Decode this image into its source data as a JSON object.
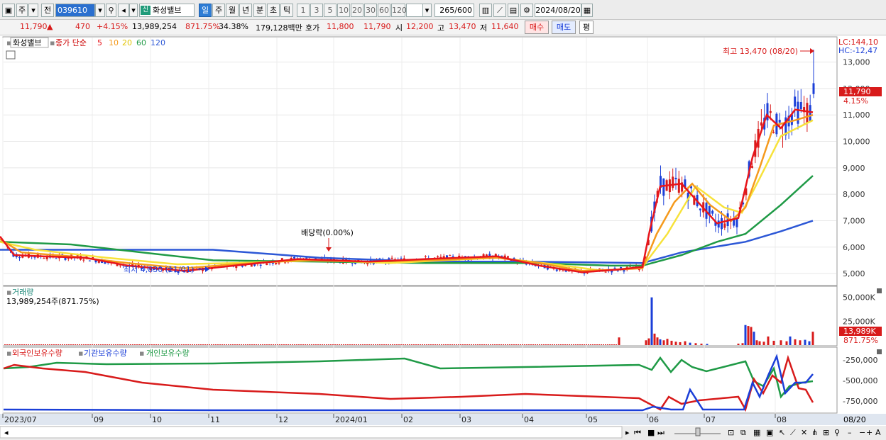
{
  "toolbar": {
    "type_label": "주",
    "all_label": "전",
    "code": "039610",
    "name_badge": "신",
    "stock_name": "화성밸브",
    "periods": [
      "일",
      "주",
      "월",
      "년",
      "분",
      "초",
      "틱"
    ],
    "active_period": "일",
    "intervals": [
      "1",
      "3",
      "5",
      "10",
      "20",
      "30",
      "60",
      "120"
    ],
    "count": "265",
    "count_max": "/600",
    "date": "2024/08/20"
  },
  "quote": {
    "price": "11,790",
    "change": "470",
    "change_pct": "+4.15%",
    "volume": "13,989,254",
    "volume_pct": "871.75%",
    "turnover": "34.38%",
    "amount": "179,128백만",
    "ask_label": "호가",
    "ask": "11,800",
    "bid": "11,790",
    "open_label": "시",
    "open": "12,200",
    "high_label": "고",
    "high": "13,470",
    "low_label": "저",
    "low": "11,640",
    "buy_label": "매수",
    "sell_label": "매도",
    "eval_label": "평"
  },
  "colors": {
    "up": "#d81b1b",
    "down": "#1b3fd8",
    "ma5": "#e8151b",
    "ma10": "#f59a1d",
    "ma20": "#f7e23a",
    "ma60": "#1f9a46",
    "ma120": "#2c57d6"
  },
  "chart_data": [
    {
      "type": "candlestick",
      "panel": "price",
      "legend": {
        "name": "화성밸브",
        "prefix": "종가 단순",
        "ma": [
          "5",
          "10",
          "20",
          "60",
          "120"
        ]
      },
      "lc_label": "LC:144,10",
      "hc_label": "HC:-12,47",
      "yticks": [
        "13,000",
        "12,000",
        "11,000",
        "10,000",
        "9,000",
        "8,000",
        "7,000",
        "6,000",
        "5,000"
      ],
      "ytick_values": [
        13000,
        12000,
        11000,
        10000,
        9000,
        8000,
        7000,
        6000,
        5000
      ],
      "ylim": [
        4600,
        13900
      ],
      "last_price_label": "11,790",
      "last_pct_label": "4.15%",
      "annotations": {
        "high": "최고 13,470 (08/20)",
        "low": "최저 4,830 (11/01)",
        "dividend": "배당락(0.00%)"
      },
      "ma_anchors": {
        "ma5": [
          [
            0,
            6400
          ],
          [
            20,
            5700
          ],
          [
            60,
            5650
          ],
          [
            120,
            5600
          ],
          [
            180,
            5300
          ],
          [
            260,
            5100
          ],
          [
            330,
            5300
          ],
          [
            420,
            5550
          ],
          [
            520,
            5450
          ],
          [
            600,
            5550
          ],
          [
            700,
            5650
          ],
          [
            760,
            5300
          ],
          [
            820,
            5050
          ],
          [
            870,
            5150
          ],
          [
            905,
            5250
          ],
          [
            915,
            6600
          ],
          [
            930,
            8300
          ],
          [
            960,
            8400
          ],
          [
            990,
            7500
          ],
          [
            1010,
            6900
          ],
          [
            1040,
            7100
          ],
          [
            1060,
            9400
          ],
          [
            1080,
            11000
          ],
          [
            1100,
            10500
          ],
          [
            1120,
            11200
          ],
          [
            1145,
            11100
          ]
        ],
        "ma10": [
          [
            0,
            6300
          ],
          [
            30,
            5800
          ],
          [
            100,
            5650
          ],
          [
            180,
            5400
          ],
          [
            260,
            5200
          ],
          [
            330,
            5350
          ],
          [
            420,
            5500
          ],
          [
            520,
            5450
          ],
          [
            600,
            5500
          ],
          [
            700,
            5600
          ],
          [
            760,
            5400
          ],
          [
            820,
            5100
          ],
          [
            870,
            5150
          ],
          [
            905,
            5200
          ],
          [
            925,
            6500
          ],
          [
            950,
            7700
          ],
          [
            975,
            8400
          ],
          [
            1000,
            7600
          ],
          [
            1030,
            7000
          ],
          [
            1050,
            7500
          ],
          [
            1070,
            9000
          ],
          [
            1090,
            10600
          ],
          [
            1120,
            10800
          ],
          [
            1145,
            11000
          ]
        ],
        "ma20": [
          [
            0,
            6200
          ],
          [
            50,
            5900
          ],
          [
            150,
            5600
          ],
          [
            250,
            5350
          ],
          [
            330,
            5400
          ],
          [
            450,
            5500
          ],
          [
            550,
            5400
          ],
          [
            700,
            5600
          ],
          [
            780,
            5350
          ],
          [
            850,
            5100
          ],
          [
            905,
            5250
          ],
          [
            940,
            6500
          ],
          [
            980,
            8300
          ],
          [
            1020,
            7500
          ],
          [
            1045,
            7300
          ],
          [
            1070,
            8600
          ],
          [
            1100,
            10200
          ],
          [
            1130,
            10600
          ],
          [
            1145,
            10800
          ]
        ],
        "ma60": [
          [
            0,
            6200
          ],
          [
            100,
            6100
          ],
          [
            200,
            5800
          ],
          [
            300,
            5500
          ],
          [
            450,
            5450
          ],
          [
            600,
            5400
          ],
          [
            750,
            5400
          ],
          [
            860,
            5300
          ],
          [
            905,
            5300
          ],
          [
            960,
            5700
          ],
          [
            1010,
            6200
          ],
          [
            1050,
            6500
          ],
          [
            1100,
            7600
          ],
          [
            1145,
            8700
          ]
        ],
        "ma120": [
          [
            0,
            5900
          ],
          [
            150,
            5900
          ],
          [
            300,
            5900
          ],
          [
            450,
            5600
          ],
          [
            600,
            5450
          ],
          [
            750,
            5450
          ],
          [
            905,
            5400
          ],
          [
            960,
            5800
          ],
          [
            1050,
            6200
          ],
          [
            1100,
            6600
          ],
          [
            1145,
            7000
          ]
        ]
      }
    },
    {
      "type": "bar",
      "panel": "volume",
      "legend": "거래량",
      "value_label": "13,989,254주(871.75%)",
      "yticks": [
        "50,000K",
        "25,000K"
      ],
      "ytick_values": [
        50000,
        25000
      ],
      "last_label": "13,989K",
      "last_pct_label": "871.75%",
      "bars": [
        [
          872,
          8000
        ],
        [
          910,
          5000
        ],
        [
          914,
          7000
        ],
        [
          918,
          50000
        ],
        [
          922,
          12000
        ],
        [
          926,
          8000
        ],
        [
          930,
          6000
        ],
        [
          935,
          5000
        ],
        [
          940,
          6500
        ],
        [
          946,
          4500
        ],
        [
          952,
          3500
        ],
        [
          958,
          3000
        ],
        [
          965,
          4000
        ],
        [
          972,
          2500
        ],
        [
          980,
          2000
        ],
        [
          988,
          1500
        ],
        [
          996,
          1200
        ],
        [
          1040,
          1500
        ],
        [
          1046,
          2000
        ],
        [
          1050,
          21000
        ],
        [
          1054,
          20000
        ],
        [
          1058,
          19000
        ],
        [
          1062,
          14000
        ],
        [
          1066,
          5000
        ],
        [
          1070,
          4000
        ],
        [
          1076,
          3500
        ],
        [
          1082,
          9000
        ],
        [
          1090,
          4500
        ],
        [
          1100,
          5000
        ],
        [
          1108,
          4000
        ],
        [
          1113,
          9000
        ],
        [
          1120,
          6000
        ],
        [
          1127,
          5000
        ],
        [
          1134,
          5500
        ],
        [
          1140,
          4000
        ],
        [
          1145,
          13989
        ]
      ]
    },
    {
      "type": "line",
      "panel": "holdings",
      "series_names": [
        "외국인보유수량",
        "기관보유수량",
        "개인보유수량"
      ],
      "yticks": [
        "-250,000",
        "-500,000",
        "-750,000"
      ],
      "ytick_values": [
        -250000,
        -500000,
        -750000
      ]
    }
  ],
  "x_axis": {
    "labels": [
      "2023/07",
      "09",
      "10",
      "11",
      "12",
      "2024/01",
      "02",
      "03",
      "04",
      "05",
      "06",
      "07",
      "08"
    ],
    "right_label": "08/20"
  }
}
